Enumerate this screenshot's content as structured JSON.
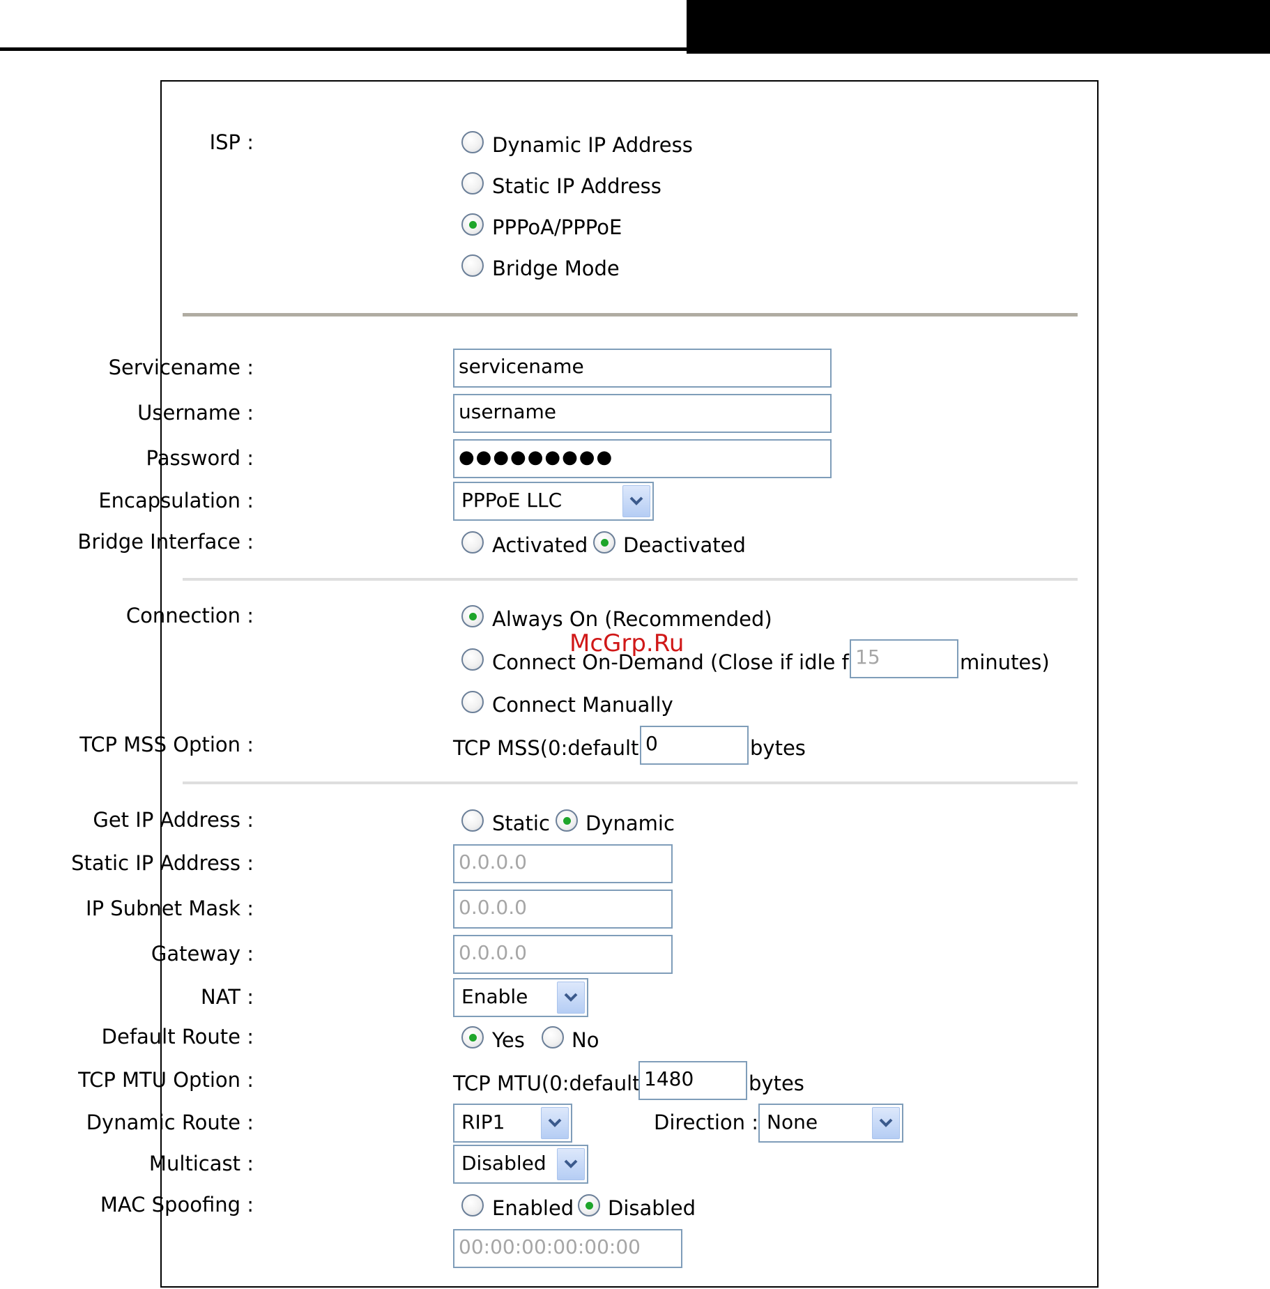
{
  "isp": {
    "label": "ISP :",
    "options": [
      "Dynamic IP Address",
      "Static IP Address",
      "PPPoA/PPPoE",
      "Bridge Mode"
    ],
    "selected": "PPPoA/PPPoE"
  },
  "servicename": {
    "label": "Servicename :",
    "value": "servicename"
  },
  "username": {
    "label": "Username :",
    "value": "username"
  },
  "password": {
    "label": "Password :",
    "value": "●●●●●●●●●"
  },
  "encapsulation": {
    "label": "Encapsulation :",
    "value": "PPPoE LLC"
  },
  "bridge_interface": {
    "label": "Bridge Interface :",
    "options": [
      "Activated",
      "Deactivated"
    ],
    "selected": "Deactivated"
  },
  "connection": {
    "label": "Connection :",
    "always_on": "Always On (Recommended)",
    "on_demand_prefix": "Connect On-Demand (Close if idle for",
    "on_demand_value": "15",
    "on_demand_suffix": "minutes)",
    "manually": "Connect Manually",
    "selected": "Always On (Recommended)"
  },
  "tcp_mss": {
    "label": "TCP MSS Option :",
    "prefix": "TCP MSS(0:default)",
    "value": "0",
    "suffix": "bytes"
  },
  "get_ip": {
    "label": "Get IP Address :",
    "options": [
      "Static",
      "Dynamic"
    ],
    "selected": "Dynamic"
  },
  "static_ip": {
    "label": "Static IP Address :",
    "value": "0.0.0.0"
  },
  "subnet_mask": {
    "label": "IP Subnet Mask :",
    "value": "0.0.0.0"
  },
  "gateway": {
    "label": "Gateway :",
    "value": "0.0.0.0"
  },
  "nat": {
    "label": "NAT :",
    "value": "Enable"
  },
  "default_route": {
    "label": "Default Route :",
    "options": [
      "Yes",
      "No"
    ],
    "selected": "Yes"
  },
  "tcp_mtu": {
    "label": "TCP MTU Option :",
    "prefix": "TCP MTU(0:default)",
    "value": "1480",
    "suffix": "bytes"
  },
  "dynamic_route": {
    "label": "Dynamic Route :",
    "value": "RIP1"
  },
  "direction": {
    "label": "Direction :",
    "value": "None"
  },
  "multicast": {
    "label": "Multicast :",
    "value": "Disabled"
  },
  "mac_spoofing": {
    "label": "MAC Spoofing :",
    "options": [
      "Enabled",
      "Disabled"
    ],
    "selected": "Disabled",
    "mac_value": "00:00:00:00:00:00"
  },
  "watermark": "McGrp.Ru",
  "colors": {
    "radio_dot": "#1ea52a",
    "input_border": "#7f9db9",
    "watermark": "#d01818",
    "separator_dark": "#b0aca2",
    "separator_light": "#dedede"
  }
}
